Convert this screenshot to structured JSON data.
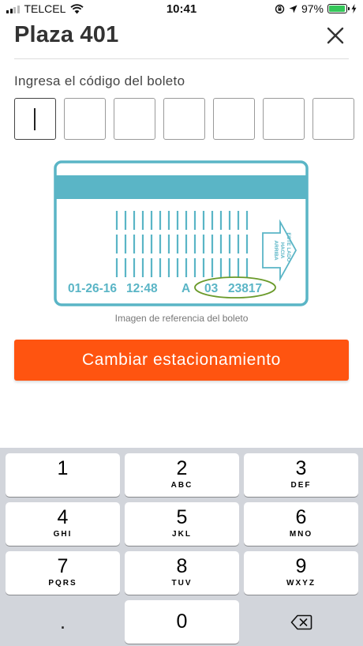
{
  "status_bar": {
    "carrier": "TELCEL",
    "time": "10:41",
    "battery_percent": "97%",
    "battery_level": 0.97,
    "battery_color": "#34c759",
    "icons": [
      "signal-icon",
      "wifi-icon",
      "rotation-lock-icon",
      "location-icon",
      "battery-icon",
      "charging-icon"
    ]
  },
  "header": {
    "title": "Plaza 401",
    "close_icon": "close-icon"
  },
  "code_entry": {
    "label": "Ingresa el código del boleto",
    "box_count": 7,
    "values": [
      "",
      "",
      "",
      "",
      "",
      "",
      ""
    ]
  },
  "ticket": {
    "date": "01-26-16",
    "time": "12:48",
    "series": "A",
    "code_prefix": "03",
    "code_number": "23817",
    "arrow_text": [
      "ESTE LADO",
      "HACIA",
      "ARRIBA"
    ],
    "accent_color": "#5ab5c6",
    "highlight_color": "#6a9a2a",
    "caption": "Imagen de referencia del boleto"
  },
  "primary_button": {
    "label": "Cambiar estacionamiento",
    "color": "#ff5410"
  },
  "keypad": {
    "keys": [
      {
        "num": "1",
        "letters": ""
      },
      {
        "num": "2",
        "letters": "ABC"
      },
      {
        "num": "3",
        "letters": "DEF"
      },
      {
        "num": "4",
        "letters": "GHI"
      },
      {
        "num": "5",
        "letters": "JKL"
      },
      {
        "num": "6",
        "letters": "MNO"
      },
      {
        "num": "7",
        "letters": "PQRS"
      },
      {
        "num": "8",
        "letters": "TUV"
      },
      {
        "num": "9",
        "letters": "WXYZ"
      }
    ],
    "dot_key": ".",
    "zero_key": "0",
    "delete_icon": "backspace-icon"
  }
}
